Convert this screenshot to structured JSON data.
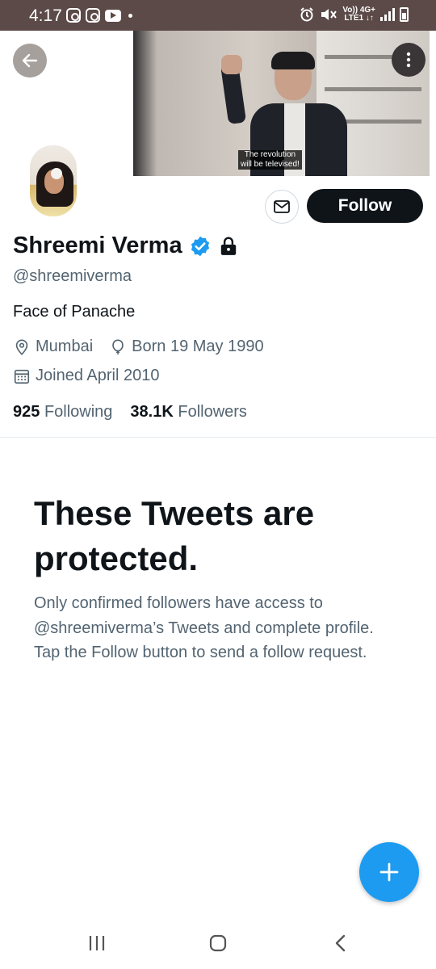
{
  "status_bar": {
    "time": "4:17",
    "net_line1": "Vo)) 4G+",
    "net_line2": "LTE1 ↓↑"
  },
  "banner": {
    "subtitle_line1": "The revolution",
    "subtitle_line2": "will be televised!"
  },
  "actions": {
    "follow_label": "Follow"
  },
  "profile": {
    "name": "Shreemi Verma",
    "handle": "@shreemiverma",
    "bio": "Face of Panache",
    "location": "Mumbai",
    "birthday": "Born 19 May 1990",
    "joined": "Joined April 2010",
    "following_count": "925",
    "following_label": "Following",
    "followers_count": "38.1K",
    "followers_label": "Followers",
    "verified": true,
    "protected": true
  },
  "protected_notice": {
    "title": "These Tweets are protected.",
    "description": "Only confirmed followers have access to @shreemiverma’s Tweets and complete profile. Tap the Follow button to send a follow request."
  },
  "colors": {
    "accent": "#1d9bf0",
    "text_primary": "#0f1419",
    "text_secondary": "#536471",
    "status_bar_bg": "#5b4a48"
  },
  "icons": [
    "back-arrow-icon",
    "more-vertical-icon",
    "mail-icon",
    "verified-badge-icon",
    "lock-icon",
    "location-pin-icon",
    "balloon-icon",
    "calendar-icon",
    "plus-icon",
    "recent-apps-icon",
    "home-icon",
    "nav-back-icon"
  ]
}
